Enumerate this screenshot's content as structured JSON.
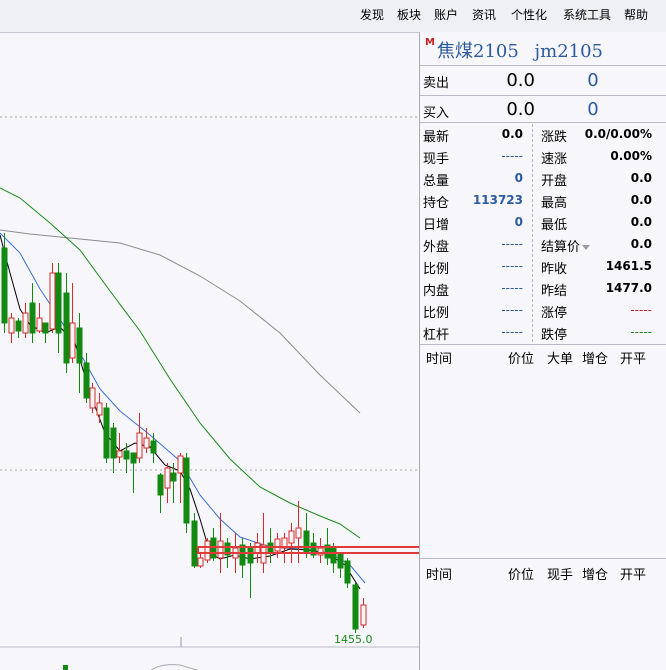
{
  "menu": [
    "发现",
    "板块",
    "账户",
    "资讯",
    "个性化",
    "系统工具",
    "帮助"
  ],
  "instrument": {
    "badge": "M",
    "name": "焦煤2105",
    "code": "jm2105"
  },
  "quote": {
    "sell": {
      "label": "卖出",
      "price": "0.0",
      "volume": "0"
    },
    "buy": {
      "label": "买入",
      "price": "0.0",
      "volume": "0"
    }
  },
  "stats_left": [
    {
      "label": "最新",
      "value": "0.0"
    },
    {
      "label": "现手",
      "value": "-----"
    },
    {
      "label": "总量",
      "value": "0"
    },
    {
      "label": "持仓",
      "value": "113723"
    },
    {
      "label": "日增",
      "value": "0"
    },
    {
      "label": "外盘",
      "value": "-----"
    },
    {
      "label": "比例",
      "value": "-----"
    },
    {
      "label": "内盘",
      "value": "-----"
    },
    {
      "label": "比例",
      "value": "-----"
    },
    {
      "label": "杠杆",
      "value": "-----"
    }
  ],
  "stats_right": [
    {
      "label": "涨跌",
      "value": "0.0/0.00%"
    },
    {
      "label": "速涨",
      "value": "0.00%"
    },
    {
      "label": "开盘",
      "value": "0.0"
    },
    {
      "label": "最高",
      "value": "0.0"
    },
    {
      "label": "最低",
      "value": "0.0"
    },
    {
      "label": "结算价",
      "value": "0.0"
    },
    {
      "label": "昨收",
      "value": "1461.5"
    },
    {
      "label": "昨结",
      "value": "1477.0"
    },
    {
      "label": "涨停",
      "value": "-----"
    },
    {
      "label": "跌停",
      "value": "-----"
    }
  ],
  "trades_header_1": [
    "时间",
    "价位",
    "大单",
    "增仓",
    "开平"
  ],
  "trades_header_2": [
    "时间",
    "价位",
    "现手",
    "增仓",
    "开平"
  ],
  "chart": {
    "last_price_label": "1455.0",
    "colors": {
      "up": "#d42a2a",
      "down": "#128a12",
      "ma_short": "#000000",
      "ma_mid": "#3a6fd8",
      "ma_long": "#1a8a1a",
      "ma_longest": "#8a8a92",
      "highlight": "#e03a3a"
    }
  }
}
